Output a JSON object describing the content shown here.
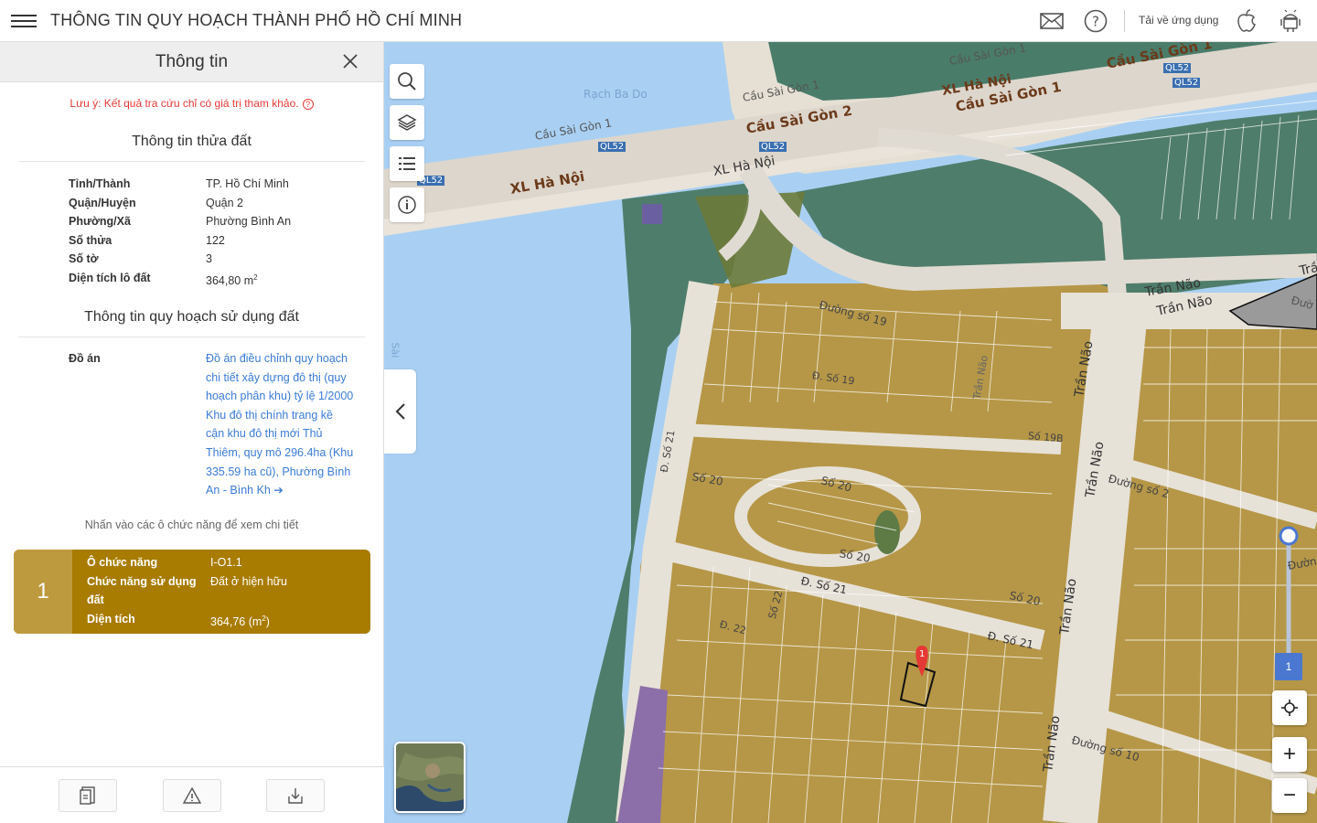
{
  "header": {
    "title": "THÔNG TIN QUY HOẠCH THÀNH PHỐ HỒ CHÍ MINH",
    "download_label": "Tải về ứng dụng",
    "icons": [
      "mail-icon",
      "help-icon",
      "apple-icon",
      "android-icon"
    ]
  },
  "panel": {
    "title": "Thông tin",
    "note": "Lưu ý: Kết quả tra cứu chỉ có giá trị tham khảo.",
    "note_icon": "?",
    "parcel_section_title": "Thông tin thửa đất",
    "parcel": [
      {
        "label": "Tỉnh/Thành",
        "value": "TP. Hồ Chí Minh"
      },
      {
        "label": "Quận/Huyện",
        "value": "Quận 2"
      },
      {
        "label": "Phường/Xã",
        "value": "Phường Bình An"
      },
      {
        "label": "Số thửa",
        "value": "122"
      },
      {
        "label": "Số tờ",
        "value": "3"
      },
      {
        "label": "Diện tích lô đất",
        "value": "364,80 m",
        "unit_sup": "2"
      }
    ],
    "planning_section_title": "Thông tin quy hoạch sử dụng đất",
    "plan_label": "Đồ án",
    "plan_value": "Đồ án điều chỉnh quy hoạch chi tiết xây dựng đô thị (quy hoạch phân khu) tỷ lệ 1/2000 Khu đô thị chính trang kề cận khu đô thị mới Thủ Thiêm, quy mô 296.4ha (Khu 335.59 ha cũ), Phường Bình An - Bình Kh",
    "hint": "Nhấn vào các ô chức năng để xem chi tiết",
    "card": {
      "number": "1",
      "rows": [
        {
          "label": "Ô chức năng",
          "value": "I-O1.1"
        },
        {
          "label": "Chức năng sử dụng đất",
          "value": "Đất ở hiện hữu"
        },
        {
          "label": "Diện tích",
          "value": "364,76 (m",
          "unit_sup": "2",
          "value_suffix": ")"
        }
      ],
      "color": "#a87c00"
    }
  },
  "map": {
    "labels": {
      "rach_ba_do": "Rạch Ba Do",
      "cau_sai_gon_1_a": "Cầu Sài Gòn 1",
      "cau_sai_gon_1_b": "Cầu Sài Gòn 1",
      "cau_sai_gon_1_c": "Cầu Sài Gòn 1",
      "cau_sai_gon_1_d": "Cầu Sài Gòn 1",
      "cau_sai_gon_1_e": "Cầu Sài Gòn 1",
      "cau_sai_gon_2": "Cầu Sài Gòn 2",
      "xl_ha_noi_a": "XL Hà Nội",
      "xl_ha_noi_b": "XL Hà Nội",
      "xl_ha_noi_c": "XL Hà Nội",
      "ql52_a": "QL52",
      "ql52_b": "QL52",
      "ql52_c": "QL52",
      "ql52_d": "QL52",
      "duong_so_19": "Đường số 19",
      "d_so_19": "Đ. Số 19",
      "so_19b": "Số 19B",
      "d_so_21_a": "Đ. Số 21",
      "d_so_21_b": "Đ. Số 21",
      "d_so_21_c": "Đ. Số 21",
      "so_20_a": "Số 20",
      "so_20_b": "Số 20",
      "so_20_c": "Số 20",
      "so_20_d": "Số 20",
      "d_22": "Đ. 22",
      "so_22": "Số 22",
      "tran_nao_a": "Trần Não",
      "tran_nao_b": "Trần Não",
      "tran_nao_c": "Trần Não",
      "tran_nao_d": "Trần Não",
      "tran_nao_e": "Trần Não",
      "tran_nao_f": "Trần Não",
      "tran_nao_g": "Trần Não",
      "duong_so_2": "Đường số 2",
      "duong_so_10": "Đường số 10",
      "duong_partial": "Đường",
      "marker_num": "1",
      "zoom_level": "1",
      "tran_partial_a": "Trầ",
      "duong_partial_b": "Đườ",
      "sai_partial": "Sài"
    }
  }
}
